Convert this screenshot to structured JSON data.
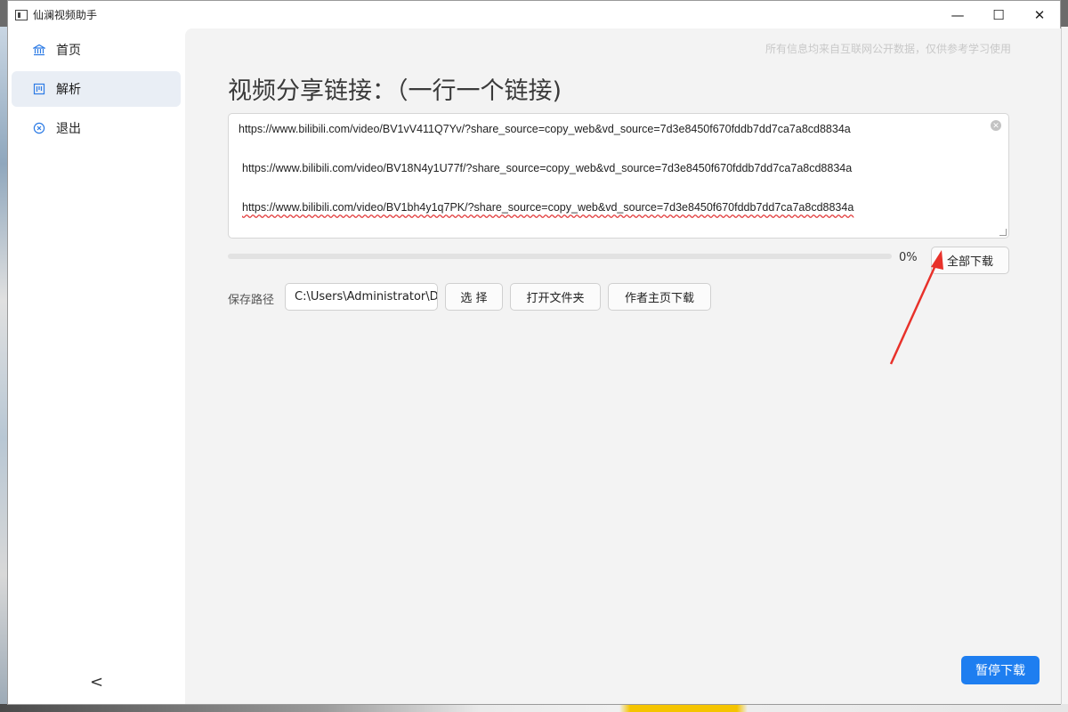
{
  "window": {
    "title": "仙澜视频助手",
    "controls": {
      "minimize": "—",
      "maximize": "☐",
      "close": "✕"
    }
  },
  "sidebar": {
    "items": [
      {
        "label": "首页",
        "icon": "bank-icon",
        "active": false
      },
      {
        "label": "解析",
        "icon": "kanban-icon",
        "active": true
      },
      {
        "label": "退出",
        "icon": "close-circle-icon",
        "active": false
      }
    ],
    "collapse_glyph": "<"
  },
  "main": {
    "notice": "所有信息均来自互联网公开数据，仅供参考学习使用",
    "heading": "视频分享链接：（一行一个链接)",
    "links": [
      "https://www.bilibili.com/video/BV1vV411Q7Yv/?share_source=copy_web&vd_source=7d3e8450f670fddb7dd7ca7a8cd8834a",
      "https://www.bilibili.com/video/BV18N4y1U77f/?share_source=copy_web&vd_source=7d3e8450f670fddb7dd7ca7a8cd8834a",
      "https://www.bilibili.com/video/BV1bh4y1q7PK/?share_source=copy_web&vd_source=7d3e8450f670fddb7dd7ca7a8cd8834a"
    ],
    "progress": {
      "value": 0,
      "label": "0%"
    },
    "download_all_label": "全部下载",
    "save_path": {
      "label": "保存路径",
      "value": "C:\\Users\\Administrator\\Desktop"
    },
    "choose_label": "选 择",
    "open_folder_label": "打开文件夹",
    "author_download_label": "作者主页下载",
    "pause_label": "暂停下载"
  },
  "colors": {
    "accent": "#1e7ef0",
    "annotation_arrow": "#e8312a",
    "active_nav_bg": "#e9eef5"
  }
}
